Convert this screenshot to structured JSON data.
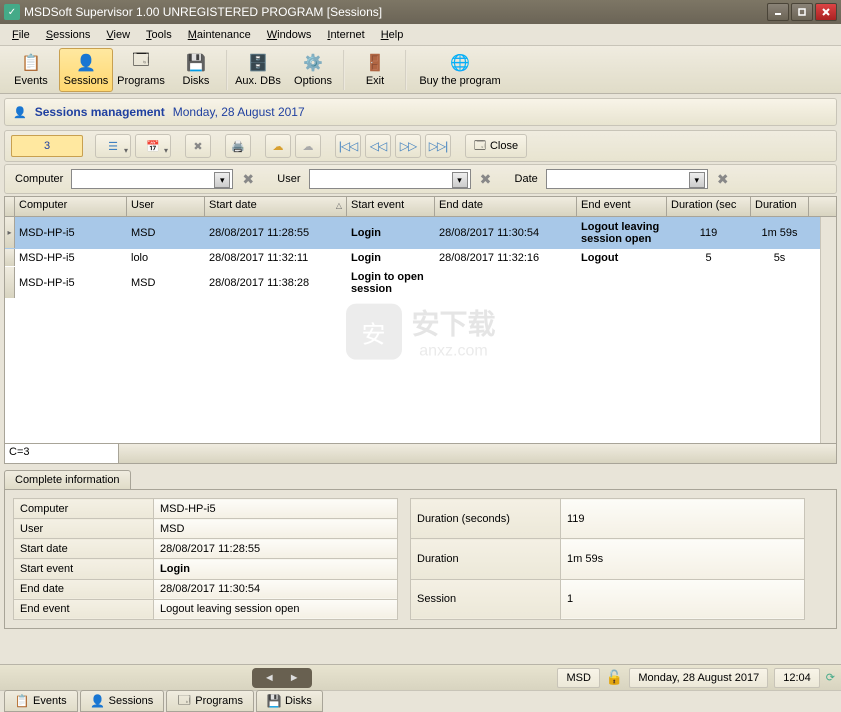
{
  "window": {
    "title": "MSDSoft Supervisor 1.00 UNREGISTERED PROGRAM [Sessions]"
  },
  "menu": {
    "file": "File",
    "sessions": "Sessions",
    "view": "View",
    "tools": "Tools",
    "maintenance": "Maintenance",
    "windows": "Windows",
    "internet": "Internet",
    "help": "Help"
  },
  "toolbar": {
    "events": "Events",
    "sessions": "Sessions",
    "programs": "Programs",
    "disks": "Disks",
    "auxdbs": "Aux. DBs",
    "options": "Options",
    "exit": "Exit",
    "buy": "Buy the program"
  },
  "section": {
    "title": "Sessions management",
    "date": "Monday, 28 August 2017"
  },
  "filterbar": {
    "num": "3",
    "close": "Close"
  },
  "filters": {
    "computer": "Computer",
    "user": "User",
    "date": "Date"
  },
  "columns": {
    "computer": "Computer",
    "user": "User",
    "startdate": "Start date",
    "startevent": "Start event",
    "enddate": "End date",
    "endevent": "End event",
    "durationsec": "Duration (seconds)",
    "duration": "Duration"
  },
  "rows": [
    {
      "computer": "MSD-HP-i5",
      "user": "MSD",
      "startdate": "28/08/2017 11:28:55",
      "startevent": "Login",
      "enddate": "28/08/2017 11:30:54",
      "endevent": "Logout leaving session open",
      "dursec": "119",
      "dur": "1m 59s",
      "sel": true
    },
    {
      "computer": "MSD-HP-i5",
      "user": "lolo",
      "startdate": "28/08/2017 11:32:11",
      "startevent": "Login",
      "enddate": "28/08/2017 11:32:16",
      "endevent": "Logout",
      "dursec": "5",
      "dur": "5s"
    },
    {
      "computer": "MSD-HP-i5",
      "user": "MSD",
      "startdate": "28/08/2017 11:38:28",
      "startevent": "Login to open session",
      "enddate": "",
      "endevent": "",
      "dursec": "",
      "dur": ""
    }
  ],
  "count": "C=3",
  "info": {
    "tab": "Complete information",
    "left": {
      "computer_l": "Computer",
      "computer_v": "MSD-HP-i5",
      "user_l": "User",
      "user_v": "MSD",
      "startdate_l": "Start date",
      "startdate_v": "28/08/2017 11:28:55",
      "startevent_l": "Start event",
      "startevent_v": "Login",
      "enddate_l": "End date",
      "enddate_v": "28/08/2017 11:30:54",
      "endevent_l": "End event",
      "endevent_v": "Logout leaving session open"
    },
    "right": {
      "dursec_l": "Duration (seconds)",
      "dursec_v": "119",
      "dur_l": "Duration",
      "dur_v": "1m 59s",
      "session_l": "Session",
      "session_v": "1"
    }
  },
  "status": {
    "user": "MSD",
    "date": "Monday, 28 August 2017",
    "time": "12:04"
  },
  "btabs": {
    "events": "Events",
    "sessions": "Sessions",
    "programs": "Programs",
    "disks": "Disks"
  },
  "watermark": {
    "top": "安下载",
    "bottom": "anxz.com"
  }
}
